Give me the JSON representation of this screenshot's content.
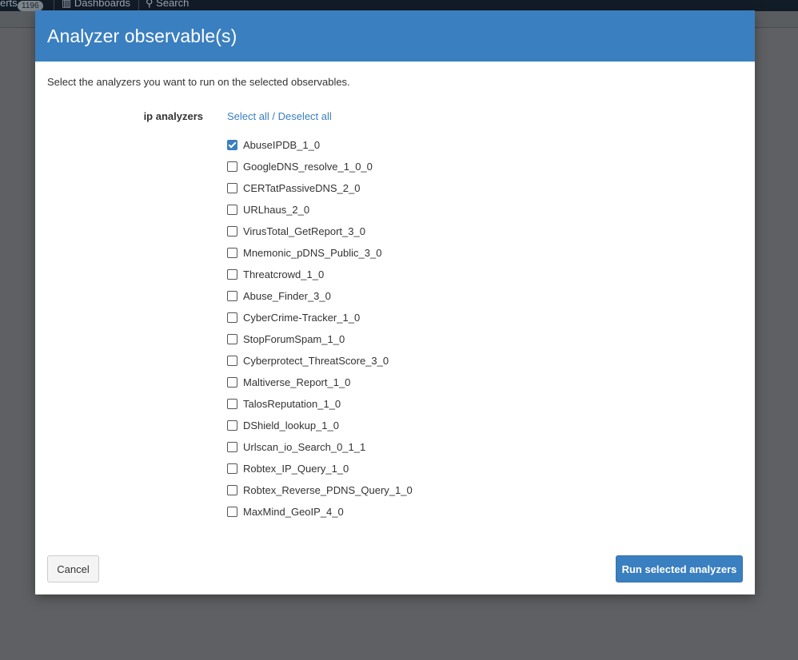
{
  "background": {
    "alerts_fragment": "erts",
    "alerts_count": "1196",
    "dashboards_label": "Dashboards",
    "search_label": "Search"
  },
  "modal": {
    "title": "Analyzer observable(s)",
    "intro": "Select the analyzers you want to run on the selected observables.",
    "group_label": "ip analyzers",
    "select_all": "Select all",
    "link_separator": " / ",
    "deselect_all": "Deselect all",
    "analyzers": [
      {
        "name": "AbuseIPDB_1_0",
        "checked": true
      },
      {
        "name": "GoogleDNS_resolve_1_0_0",
        "checked": false
      },
      {
        "name": "CERTatPassiveDNS_2_0",
        "checked": false
      },
      {
        "name": "URLhaus_2_0",
        "checked": false
      },
      {
        "name": "VirusTotal_GetReport_3_0",
        "checked": false
      },
      {
        "name": "Mnemonic_pDNS_Public_3_0",
        "checked": false
      },
      {
        "name": "Threatcrowd_1_0",
        "checked": false
      },
      {
        "name": "Abuse_Finder_3_0",
        "checked": false
      },
      {
        "name": "CyberCrime-Tracker_1_0",
        "checked": false
      },
      {
        "name": "StopForumSpam_1_0",
        "checked": false
      },
      {
        "name": "Cyberprotect_ThreatScore_3_0",
        "checked": false
      },
      {
        "name": "Maltiverse_Report_1_0",
        "checked": false
      },
      {
        "name": "TalosReputation_1_0",
        "checked": false
      },
      {
        "name": "DShield_lookup_1_0",
        "checked": false
      },
      {
        "name": "Urlscan_io_Search_0_1_1",
        "checked": false
      },
      {
        "name": "Robtex_IP_Query_1_0",
        "checked": false
      },
      {
        "name": "Robtex_Reverse_PDNS_Query_1_0",
        "checked": false
      },
      {
        "name": "MaxMind_GeoIP_4_0",
        "checked": false
      }
    ],
    "cancel_label": "Cancel",
    "run_label": "Run selected analyzers"
  },
  "colors": {
    "accent": "#3a7fc0",
    "overlay": "#5e6063",
    "topbar": "#121c27"
  }
}
